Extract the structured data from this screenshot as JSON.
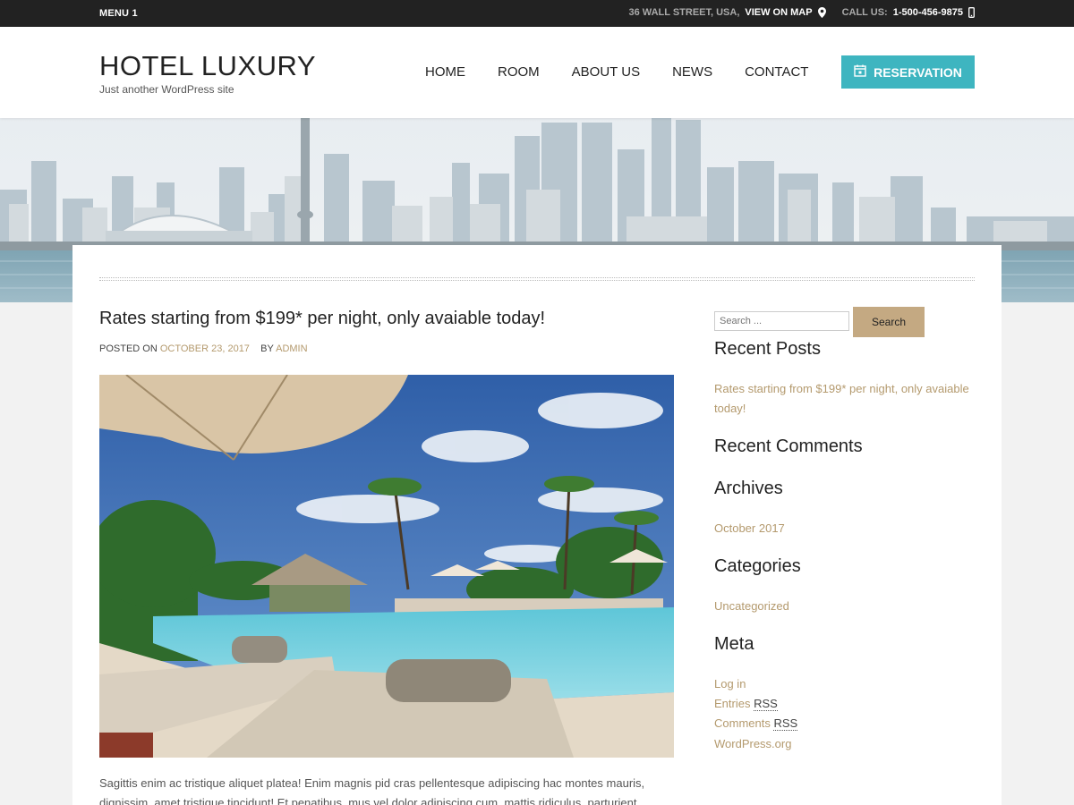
{
  "topbar": {
    "menu_label": "MENU 1",
    "address": "36 WALL STREET, USA,",
    "map_link": "VIEW ON MAP",
    "call_label": "CALL US:",
    "phone": "1-500-456-9875"
  },
  "header": {
    "site_title": "HOTEL LUXURY",
    "tagline": "Just another WordPress site",
    "nav": [
      "HOME",
      "ROOM",
      "ABOUT US",
      "NEWS",
      "CONTACT"
    ],
    "reservation_label": "RESERVATION",
    "accent_color": "#3eb5c0"
  },
  "post": {
    "title": "Rates starting from $199* per night, only avaiable today!",
    "posted_on_label": "POSTED ON",
    "date": "OCTOBER 23, 2017",
    "by_label": "BY",
    "author": "ADMIN",
    "excerpt": "Sagittis enim ac tristique aliquet platea! Enim magnis pid cras pellentesque adipiscing hac montes mauris, dignissim, amet tristique tincidunt! Et penatibus, mus vel dolor adipiscing cum, mattis ridiculus, parturient mattis."
  },
  "sidebar": {
    "search_placeholder": "Search ...",
    "search_button": "Search",
    "recent_posts_title": "Recent Posts",
    "recent_post_link": "Rates starting from $199* per night, only avaiable today!",
    "recent_comments_title": "Recent Comments",
    "archives_title": "Archives",
    "archive_link": "October 2017",
    "categories_title": "Categories",
    "category_link": "Uncategorized",
    "meta_title": "Meta",
    "meta_login": "Log in",
    "meta_entries": "Entries",
    "meta_comments": "Comments",
    "meta_rss": "RSS",
    "meta_wordpress": "WordPress.org",
    "link_color": "#b49a6e",
    "button_color": "#c4a982"
  }
}
